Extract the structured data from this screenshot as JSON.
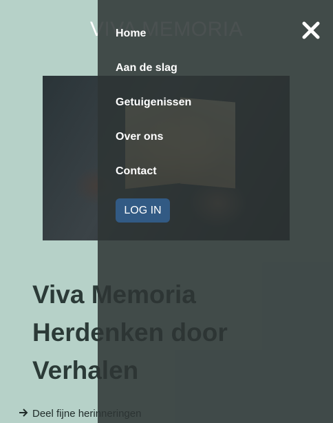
{
  "header": {
    "site_title": "VIVA MEMORIA"
  },
  "menu": {
    "items": [
      {
        "label": "Home"
      },
      {
        "label": "Aan de slag"
      },
      {
        "label": "Getuigenissen"
      },
      {
        "label": "Over ons"
      },
      {
        "label": "Contact"
      }
    ],
    "login_label": "LOG IN"
  },
  "main": {
    "heading_lines": [
      "Viva Memoria",
      "Herdenken door",
      "Verhalen"
    ],
    "cta_link": "Deel fijne herinneringen"
  },
  "icons": {
    "close": "close-icon",
    "arrow": "arrow-right-icon"
  },
  "colors": {
    "page_bg": "#b6d1c8",
    "overlay": "#2d3434",
    "login_button": "#325a84",
    "heading": "#2b3a37"
  }
}
